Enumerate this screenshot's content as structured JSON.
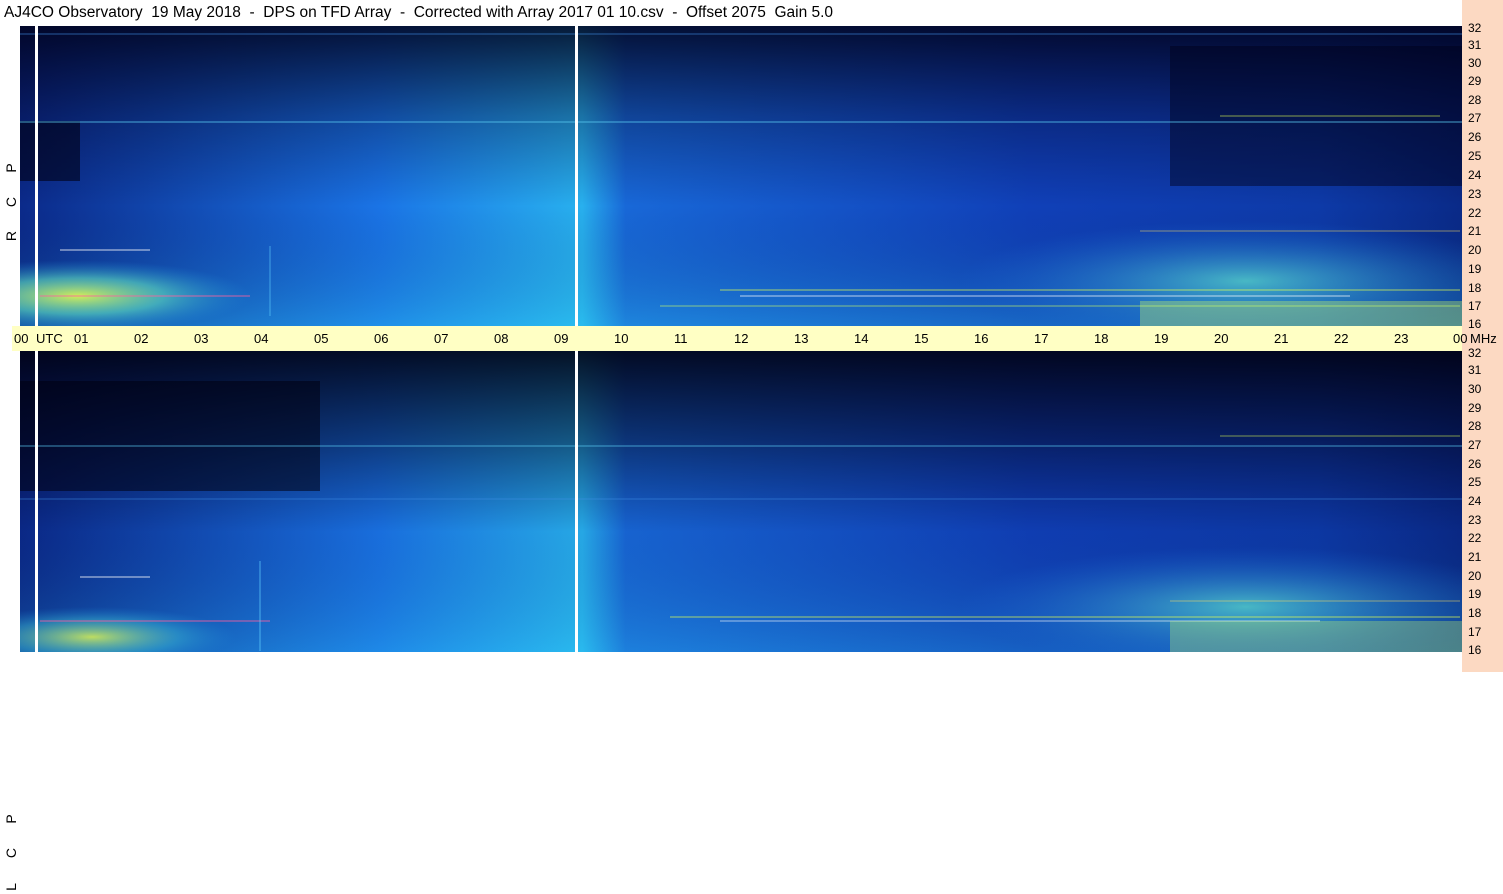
{
  "header": {
    "title": "AJ4CO Observatory  19 May 2018  -  DPS on TFD Array  -  Corrected with Array 2017 01 10.csv  -  Offset 2075  Gain 5.0"
  },
  "panels": [
    {
      "polarization": [
        "R",
        "C",
        "P"
      ]
    },
    {
      "polarization": [
        "L",
        "C",
        "P"
      ]
    }
  ],
  "time_axis": {
    "labels": [
      "00",
      "01",
      "02",
      "03",
      "04",
      "05",
      "06",
      "07",
      "08",
      "09",
      "10",
      "11",
      "12",
      "13",
      "14",
      "15",
      "16",
      "17",
      "18",
      "19",
      "20",
      "21",
      "22",
      "23",
      "00"
    ],
    "start_unit": "UTC",
    "end_unit": "MHz"
  },
  "freq_axis": {
    "labels": [
      "32",
      "31",
      "30",
      "29",
      "28",
      "27",
      "26",
      "25",
      "24",
      "23",
      "22",
      "21",
      "20",
      "19",
      "18",
      "17",
      "16"
    ]
  },
  "colors": {
    "side_strip": "#fcd9c2",
    "time_bar": "#ffffc4",
    "spectrogram_dark": "#000030",
    "spectrogram_mid": "#1a6ae0",
    "spectrogram_bright": "#30c8f0",
    "hot": "#f0ff40"
  }
}
